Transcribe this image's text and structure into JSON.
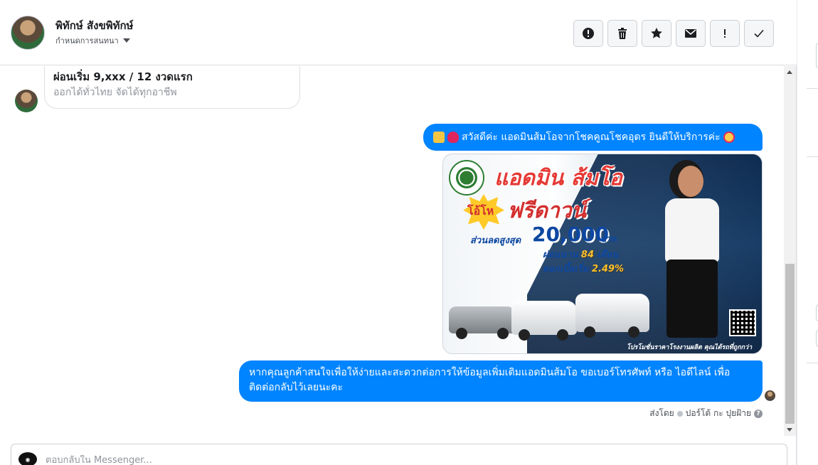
{
  "header": {
    "contact_name": "พิทักษ์ สังขพิทักษ์",
    "assign_label": "กำหนดการสนทนา"
  },
  "toolbar": {
    "buttons": [
      {
        "name": "spam",
        "icon": "alert-circle-icon"
      },
      {
        "name": "delete",
        "icon": "trash-icon"
      },
      {
        "name": "star",
        "icon": "star-icon"
      },
      {
        "name": "mark-unread",
        "icon": "envelope-icon"
      },
      {
        "name": "follow-up",
        "icon": "exclamation-icon"
      },
      {
        "name": "done",
        "icon": "checkmark-icon"
      }
    ]
  },
  "messages": {
    "incoming_card": {
      "title": "ผ่อนเริ่ม 9,xxx / 12 งวดแรก",
      "subtitle": "ออกได้ทั่วไทย จัดได้ทุกอาชีพ"
    },
    "greeting": "สวัสดีค่ะ แอดมินส้มโอจากโชคคูณโชคอุดร ยินดีให้บริการค่ะ",
    "promo_image": {
      "title": "แอดมิน ส้มโอ",
      "badge": "โอ้โห",
      "headline": "ฟรีดาวน์",
      "discount_label": "ส่วนลดสูงสุด",
      "discount_value": "20,000",
      "currency": "บาท",
      "term_label": "ผ่อนนาน",
      "term_value": "84",
      "term_unit": "เดือน",
      "rate_label": "ดอกเบี้ยเริ่ม",
      "rate_value": "2.49%",
      "footer": "โปรโมชั่นราคาโรงงานผลิต คุณได้รถที่ถูกกว่า"
    },
    "follow_up": "หากคุณลูกค้าสนใจเพื่อให้ง่ายและสะดวกต่อการให้ข้อมูลเพิ่มเติมแอดมินส้มโอ ขอเบอร์โทรศัพท์ หรือ ไอดีไลน์ เพื่อติดต่อกลับไว้เลยนะคะ",
    "sent_by_label": "ส่งโดย",
    "sender_name": "ปอร์โต้ กะ ปุยฝ้าย"
  },
  "composer": {
    "placeholder": "ตอบกลับใน Messenger..."
  },
  "colors": {
    "accent": "#0084ff",
    "text": "#1c1e21",
    "muted": "#90949c",
    "border": "#dadde1"
  }
}
